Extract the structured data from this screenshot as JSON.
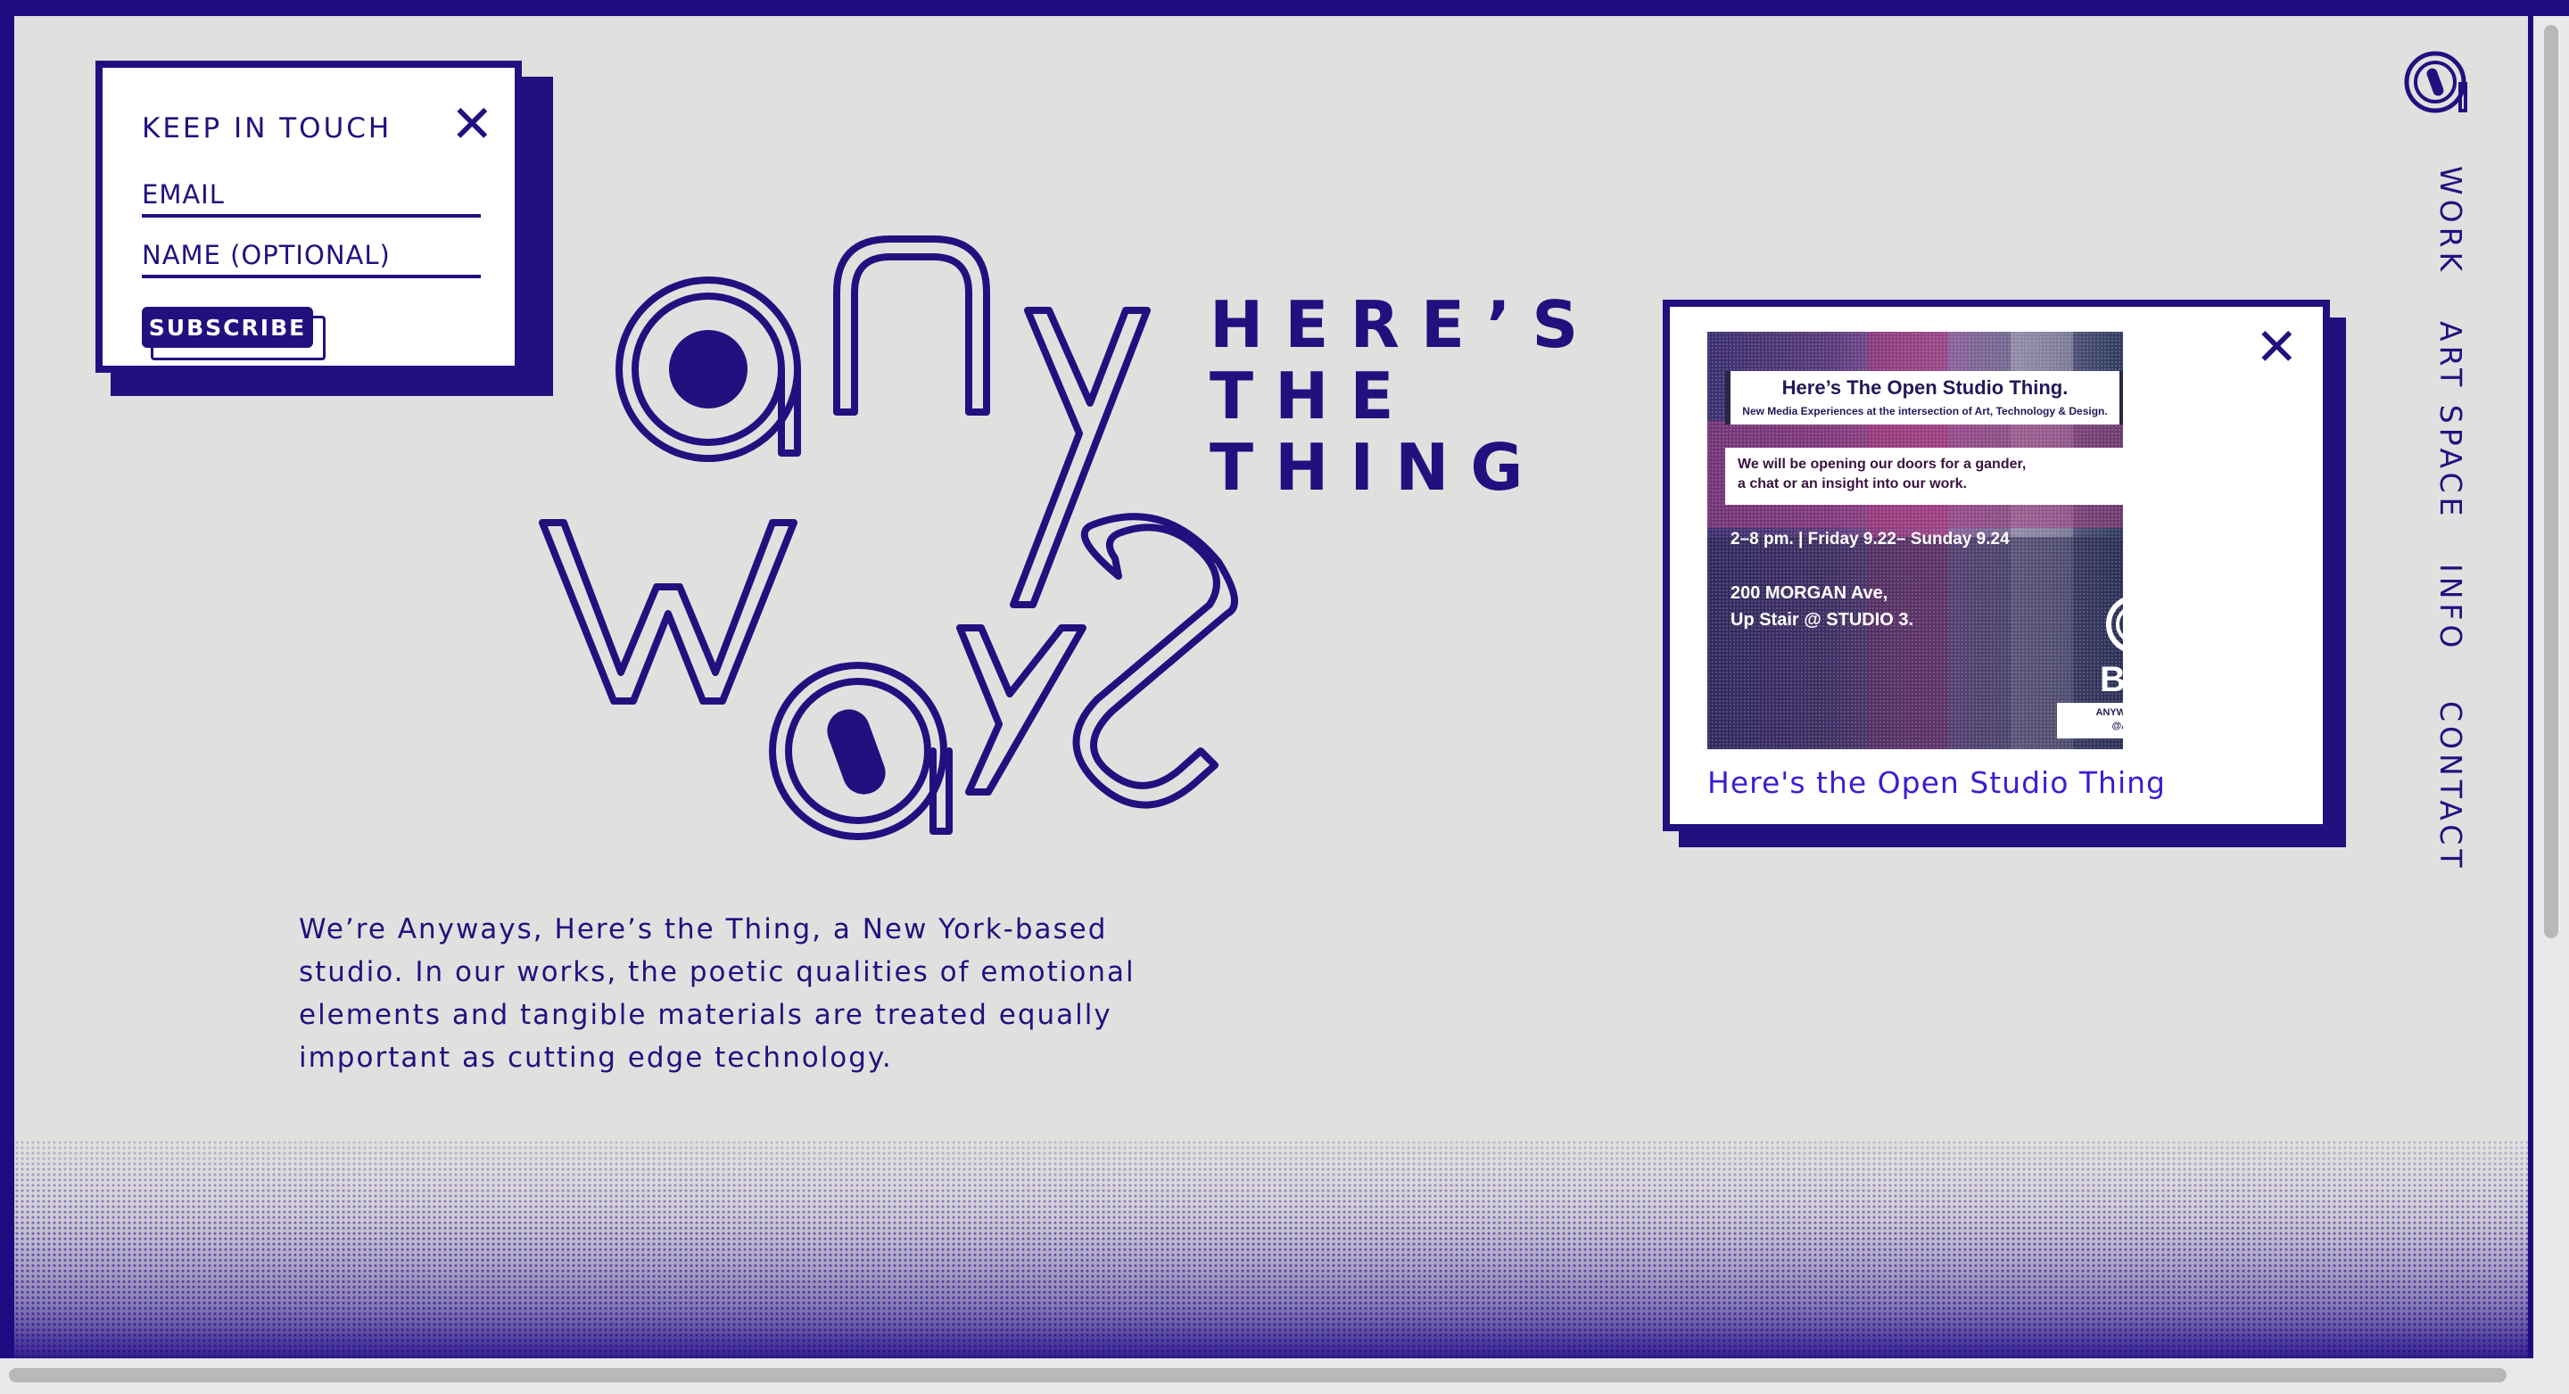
{
  "newsletter": {
    "title": "KEEP IN TOUCH",
    "close_glyph": "✕",
    "email_placeholder": "EMAIL",
    "name_placeholder": "NAME (OPTIONAL)",
    "subscribe_label": "SUBSCRIBE"
  },
  "logo": {
    "tagline_lines": [
      "HERE’S",
      "THE",
      "THING"
    ]
  },
  "intro": {
    "text": "We’re Anyways, Here’s the Thing, a New York-based studio. In our works, the poetic qualities of emotional elements and tangible materials are treated equally important as cutting edge technology."
  },
  "event_card": {
    "close_glyph": "✕",
    "poster": {
      "title": "Here’s The Open Studio Thing.",
      "subtitle": "New Media Experiences at the intersection of Art, Technology & Design.",
      "invite_line1": "We will be opening our doors for a gander,",
      "invite_line2": "a chat or an insight into our work.",
      "when": "2–8 pm.  |  Friday 9.22– Sunday 9.24",
      "address_line1": "200 MORGAN Ave,",
      "address_line2": "Up Stair @ STUDIO 3.",
      "partner": "BOS",
      "url_line1": "ANYWAYSNYC.COM",
      "url_line2": "@ANYWAYSNYC"
    },
    "caption": "Here's the Open Studio Thing"
  },
  "nav": {
    "items": [
      "WORK",
      "ART SPACE",
      "INFO",
      "CONTACT"
    ]
  },
  "colors": {
    "brand": "#23107f",
    "background": "#e2e0df",
    "frame": "#1f0a82",
    "link": "#3b1ed1"
  }
}
